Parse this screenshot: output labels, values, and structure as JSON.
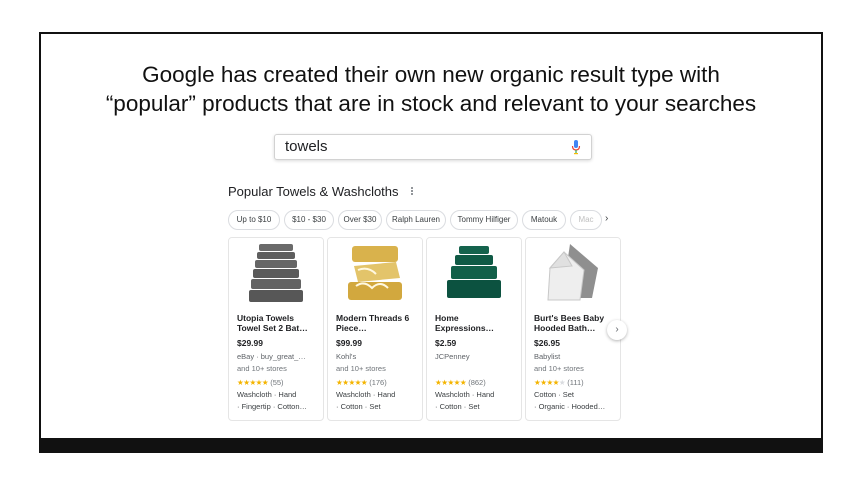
{
  "slide": {
    "headline_line1": "Google has created their own new organic result type with",
    "headline_line2": "“popular” products that are in stock and relevant to your searches"
  },
  "search": {
    "query": "towels",
    "icon": "mic-icon"
  },
  "module": {
    "title": "Popular Towels & Washcloths",
    "chips": [
      "Up to $10",
      "$10 - $30",
      "Over $30",
      "Ralph Lauren",
      "Tommy Hilfiger",
      "Matouk",
      "Mac"
    ],
    "chips_next": "›"
  },
  "products": [
    {
      "title": "Utopia Towels Towel Set 2 Bat…",
      "price": "$29.99",
      "store": "eBay · buy_great_…",
      "more_stores": "and 10+ stores",
      "stars": "★★★★★",
      "rating_count": "(55)",
      "tag1": "Washcloth · Hand",
      "tag2": "· Fingertip · Cotton…",
      "color": "#5b5b5b"
    },
    {
      "title": "Modern Threads 6 Piece…",
      "price": "$99.99",
      "store": "Kohl's",
      "more_stores": "and 10+ stores",
      "stars": "★★★★★",
      "rating_count": "(176)",
      "tag1": "Washcloth · Hand",
      "tag2": "· Cotton · Set",
      "color": "#d9b24c"
    },
    {
      "title": "Home Expressions…",
      "price": "$2.59",
      "store": "JCPenney",
      "more_stores": "",
      "stars": "★★★★★",
      "rating_count": "(862)",
      "tag1": "Washcloth · Hand",
      "tag2": "· Cotton · Set",
      "color": "#0f5a45"
    },
    {
      "title": "Burt's Bees Baby Hooded Bath…",
      "price": "$26.95",
      "store": "Babylist",
      "more_stores": "and 10+ stores",
      "stars": "★★★★",
      "rating_count": "(111)",
      "tag1": "Cotton · Set",
      "tag2": "· Organic · Hooded…",
      "color": "#9a9a9a"
    }
  ],
  "carousel_next": "›"
}
